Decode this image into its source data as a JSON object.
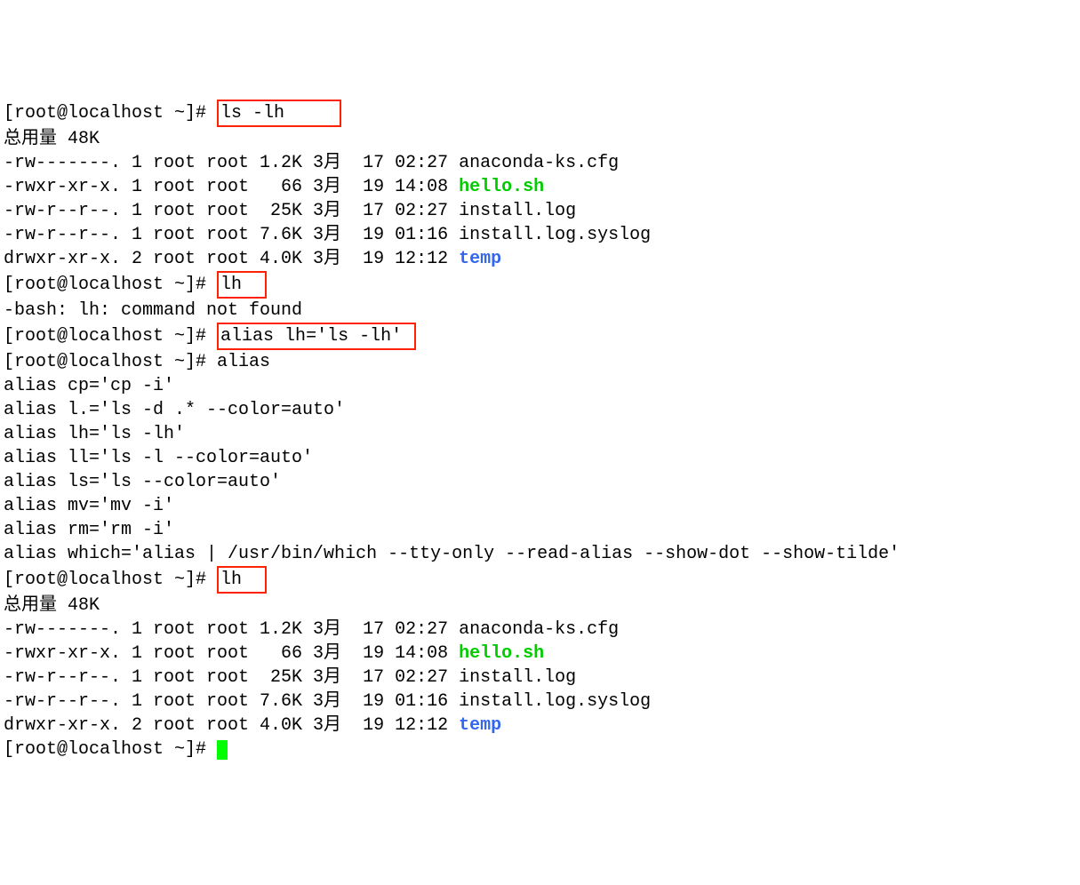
{
  "prompt": "[root@localhost ~]# ",
  "cmd_ls": "ls -lh",
  "total1": "总用量 48K",
  "files": [
    {
      "perm": "-rw-------.",
      "links": "1",
      "owner": "root",
      "group": "root",
      "size": "1.2K",
      "month": "3月",
      "day": "17",
      "time": "02:27",
      "name": "anaconda-ks.cfg",
      "style": ""
    },
    {
      "perm": "-rwxr-xr-x.",
      "links": "1",
      "owner": "root",
      "group": "root",
      "size": "  66",
      "month": "3月",
      "day": "19",
      "time": "14:08",
      "name": "hello.sh",
      "style": "green"
    },
    {
      "perm": "-rw-r--r--.",
      "links": "1",
      "owner": "root",
      "group": "root",
      "size": " 25K",
      "month": "3月",
      "day": "17",
      "time": "02:27",
      "name": "install.log",
      "style": ""
    },
    {
      "perm": "-rw-r--r--.",
      "links": "1",
      "owner": "root",
      "group": "root",
      "size": "7.6K",
      "month": "3月",
      "day": "19",
      "time": "01:16",
      "name": "install.log.syslog",
      "style": ""
    },
    {
      "perm": "drwxr-xr-x.",
      "links": "2",
      "owner": "root",
      "group": "root",
      "size": "4.0K",
      "month": "3月",
      "day": "19",
      "time": "12:12",
      "name": "temp",
      "style": "blue"
    }
  ],
  "cmd_lh": "lh",
  "err_lh": "-bash: lh: command not found",
  "cmd_alias_def": "alias lh='ls -lh'",
  "cmd_alias": "alias",
  "aliases": [
    "alias cp='cp -i'",
    "alias l.='ls -d .* --color=auto'",
    "alias lh='ls -lh'",
    "alias ll='ls -l --color=auto'",
    "alias ls='ls --color=auto'",
    "alias mv='mv -i'",
    "alias rm='rm -i'",
    "alias which='alias | /usr/bin/which --tty-only --read-alias --show-dot --show-tilde'"
  ],
  "total2": "总用量 48K"
}
